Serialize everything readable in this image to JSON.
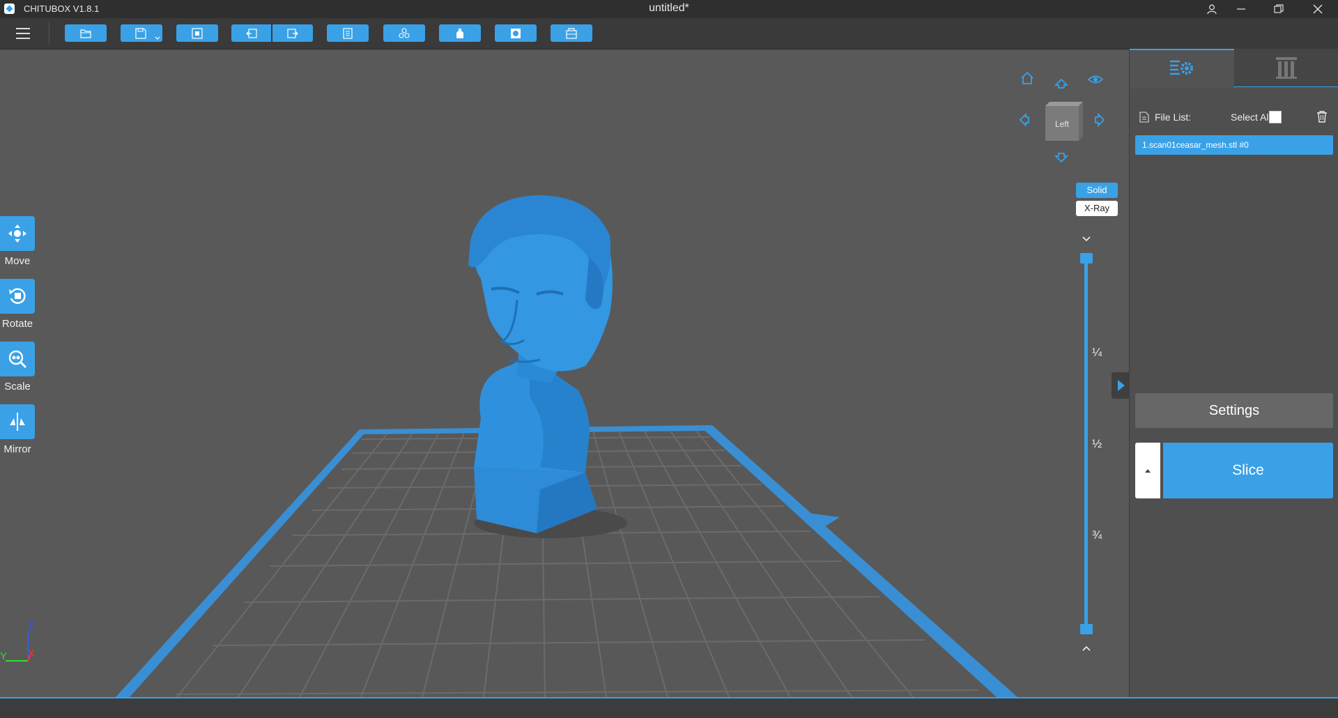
{
  "window": {
    "app_title": "CHITUBOX V1.8.1",
    "document_title": "untitled*"
  },
  "tools": {
    "move": "Move",
    "rotate": "Rotate",
    "scale": "Scale",
    "mirror": "Mirror"
  },
  "view_cube": {
    "face_label": "Left"
  },
  "render_mode": {
    "solid": "Solid",
    "xray": "X-Ray",
    "selected": "Solid"
  },
  "layer_slider": {
    "tick_quarter": "¼",
    "tick_half": "½",
    "tick_three_quarter": "¾"
  },
  "panel": {
    "file_list_label": "File List:",
    "select_all_label": "Select All",
    "files": [
      "1.scan01ceasar_mesh.stl #0"
    ],
    "settings_label": "Settings",
    "slice_label": "Slice"
  },
  "axes": {
    "z": "Z",
    "y": "Y",
    "x": "X"
  },
  "colors": {
    "accent": "#3aa1e6",
    "model": "#2f8fdc",
    "background": "#595959"
  }
}
